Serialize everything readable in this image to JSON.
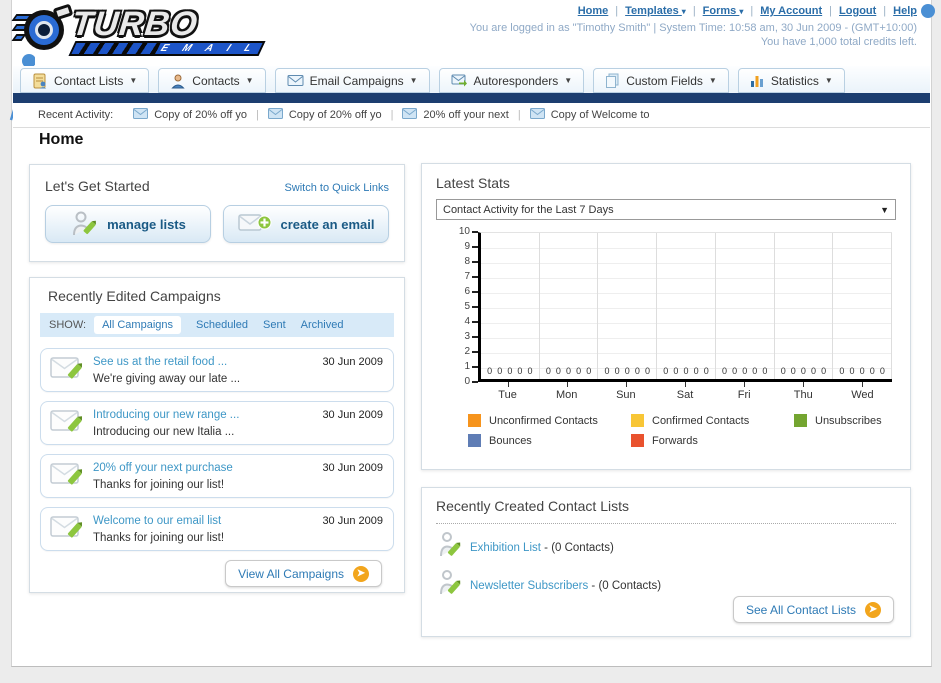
{
  "header": {
    "logo_title": "TURBO",
    "logo_subtitle": "E M A I L",
    "links": [
      {
        "label": "Home",
        "dropdown": false
      },
      {
        "label": "Templates",
        "dropdown": true
      },
      {
        "label": "Forms",
        "dropdown": true
      },
      {
        "label": "My Account",
        "dropdown": false
      },
      {
        "label": "Logout",
        "dropdown": false
      },
      {
        "label": "Help",
        "dropdown": false
      }
    ],
    "login_info": "You are logged in as \"Timothy Smith\" | System Time: 10:58 am, 30 Jun 2009 - (GMT+10:00)",
    "credits_info": "You have 1,000 total credits left."
  },
  "nav": {
    "tabs": [
      {
        "label": "Contact Lists",
        "icon": "contact-lists-icon"
      },
      {
        "label": "Contacts",
        "icon": "contacts-icon"
      },
      {
        "label": "Email Campaigns",
        "icon": "email-campaigns-icon"
      },
      {
        "label": "Autoresponders",
        "icon": "autoresponders-icon"
      },
      {
        "label": "Custom Fields",
        "icon": "custom-fields-icon"
      },
      {
        "label": "Statistics",
        "icon": "statistics-icon"
      }
    ]
  },
  "recent_activity": {
    "label": "Recent Activity:",
    "items": [
      "Copy of 20% off yo",
      "Copy of 20% off yo",
      "20% off your next",
      "Copy of Welcome to"
    ]
  },
  "page_title": "Home",
  "get_started": {
    "title": "Let's Get Started",
    "switch_link": "Switch to Quick Links",
    "buttons": [
      {
        "label": "manage lists",
        "icon": "manage-lists-icon"
      },
      {
        "label": "create an email",
        "icon": "create-email-icon"
      }
    ]
  },
  "campaigns": {
    "title": "Recently Edited Campaigns",
    "show_label": "SHOW:",
    "tabs": [
      {
        "label": "All Campaigns",
        "active": true
      },
      {
        "label": "Scheduled",
        "active": false
      },
      {
        "label": "Sent",
        "active": false
      },
      {
        "label": "Archived",
        "active": false
      }
    ],
    "items": [
      {
        "title": "See us at the retail food ...",
        "subtitle": "We're giving away our late ...",
        "date": "30 Jun 2009"
      },
      {
        "title": "Introducing our new range ...",
        "subtitle": "Introducing our new Italia ...",
        "date": "30 Jun 2009"
      },
      {
        "title": "20% off your next purchase",
        "subtitle": "Thanks for joining our list!",
        "date": "30 Jun 2009"
      },
      {
        "title": "Welcome to our email list",
        "subtitle": "Thanks for joining our list!",
        "date": "30 Jun 2009"
      }
    ],
    "view_all_label": "View All Campaigns"
  },
  "latest_stats": {
    "title": "Latest Stats",
    "selected_option": "Contact Activity for the Last 7 Days"
  },
  "chart_data": {
    "type": "bar",
    "title": "Contact Activity for the Last 7 Days",
    "categories": [
      "Tue",
      "Mon",
      "Sun",
      "Sat",
      "Fri",
      "Thu",
      "Wed"
    ],
    "series": [
      {
        "name": "Unconfirmed Contacts",
        "color": "#F6941D",
        "values": [
          0,
          0,
          0,
          0,
          0,
          0,
          0
        ]
      },
      {
        "name": "Confirmed Contacts",
        "color": "#F8C636",
        "values": [
          0,
          0,
          0,
          0,
          0,
          0,
          0
        ]
      },
      {
        "name": "Unsubscribes",
        "color": "#74A530",
        "values": [
          0,
          0,
          0,
          0,
          0,
          0,
          0
        ]
      },
      {
        "name": "Bounces",
        "color": "#5F7DB5",
        "values": [
          0,
          0,
          0,
          0,
          0,
          0,
          0
        ]
      },
      {
        "name": "Forwards",
        "color": "#E9522E",
        "values": [
          0,
          0,
          0,
          0,
          0,
          0,
          0
        ]
      }
    ],
    "ylim": [
      0,
      10
    ],
    "yticks": [
      0,
      1,
      2,
      3,
      4,
      5,
      6,
      7,
      8,
      9,
      10
    ],
    "grid": "vertical-and-faint-horizontal",
    "legend_position": "bottom",
    "xlabel": "",
    "ylabel": ""
  },
  "contact_lists": {
    "title": "Recently Created Contact Lists",
    "items": [
      {
        "name": "Exhibition List",
        "suffix": " - (0 Contacts)"
      },
      {
        "name": "Newsletter Subscribers",
        "suffix": " - (0 Contacts)"
      }
    ],
    "see_all_label": "See All Contact Lists"
  },
  "colors": {
    "navy_band": "#1C3E70",
    "link_blue": "#2E7AB5",
    "item_link_blue": "#3E97C6",
    "muted_login_text": "#8FA9C6",
    "accent_orange": "#F2A51C",
    "logo_blue": "#1D55C8"
  }
}
